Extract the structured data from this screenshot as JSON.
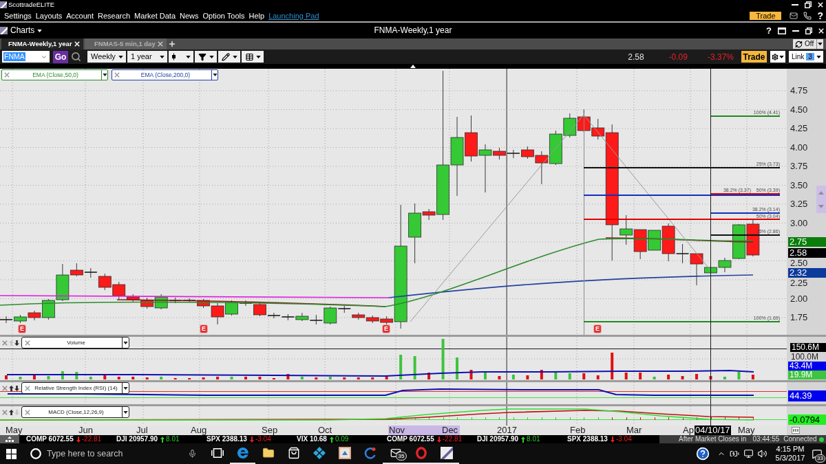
{
  "window": {
    "title": "ScottradeELITE"
  },
  "menu": [
    {
      "label": "Settings",
      "kind": "menu"
    },
    {
      "label": "Layouts",
      "kind": "menu"
    },
    {
      "label": "Account",
      "kind": "menu"
    },
    {
      "label": "Research",
      "kind": "menu"
    },
    {
      "label": "Market Data",
      "kind": "menu"
    },
    {
      "label": "News",
      "kind": "menu"
    },
    {
      "label": "Option Tools",
      "kind": "menu"
    },
    {
      "label": "Help",
      "kind": "menu"
    },
    {
      "label": "Launching Pad",
      "kind": "link"
    }
  ],
  "header_actions": {
    "trade": "Trade",
    "help": "?"
  },
  "panel": {
    "title": "Charts",
    "caption": "FNMA-Weekly,1 year",
    "help": "?"
  },
  "tabs": [
    {
      "label": "FNMA-Weekly,1 year",
      "selected": true
    },
    {
      "label": "FNMAS-5 min,1 day",
      "selected": false
    }
  ],
  "sync": {
    "label": "Off"
  },
  "toolbar": {
    "symbol": "FNMA",
    "go": "Go",
    "interval": "Weekly",
    "range": "1 year"
  },
  "quote": {
    "last": "2.58",
    "change": "-0.09",
    "change_percent": "-3.37%",
    "negative": true,
    "trade": "Trade",
    "link": "Link",
    "link_group": "3"
  },
  "studies": [
    {
      "label": "EMA (Close,50,0)",
      "color": "#2e8b2e"
    },
    {
      "label": "EMA (Close,200,0)",
      "color": "#2440a0"
    }
  ],
  "price_axis": [
    "4.75",
    "4.50",
    "4.25",
    "4.00",
    "3.75",
    "3.50",
    "3.25",
    "3.00",
    "2.50",
    "2.25",
    "2.00",
    "1.75"
  ],
  "price_badges": [
    {
      "value": "2.75",
      "color": "#0a7d0a"
    },
    {
      "value": "2.58",
      "color": "#000000"
    },
    {
      "value": "2.32",
      "color": "#0b3a9c"
    }
  ],
  "fib_levels": [
    {
      "label": "100% (4.41)",
      "color": "#1f8a1f"
    },
    {
      "label": "25% (3.73)",
      "color": "#111111"
    },
    {
      "label": "38.2% (3.37)",
      "color": "#1030c0"
    },
    {
      "label": "50% (3.39)",
      "color": "#e00000"
    },
    {
      "label": "38.2% (3.14)",
      "color": "#1030c0"
    },
    {
      "label": "50% (3.04)",
      "color": "#e00000"
    },
    {
      "label": "25% (2.86)",
      "color": "#111111"
    },
    {
      "label": "100% (1.69)",
      "color": "#1f8a1f"
    }
  ],
  "earnings_markers": [
    "E",
    "E",
    "E",
    "E"
  ],
  "volume": {
    "title": "Volume",
    "up_disabled": true,
    "down_disabled": false,
    "scale": [
      {
        "value": "150.6M",
        "kind": "marker"
      },
      {
        "value": "100.0M",
        "kind": "tick"
      },
      {
        "value": "43.4M",
        "kind": "series",
        "color": "#0000ee"
      },
      {
        "value": "19.9M",
        "kind": "series",
        "color": "#3ec43e"
      }
    ]
  },
  "rsi": {
    "title": "Relative Strength Index (RSI) (14)",
    "up_disabled": false,
    "down_disabled": false,
    "value": "44.39"
  },
  "macd": {
    "title": "MACD (Close,12,26,9)",
    "up_disabled": false,
    "down_disabled": true,
    "value": "-0.0794"
  },
  "x_axis": [
    {
      "label": "May",
      "kind": "period",
      "highlighted": false
    },
    {
      "label": "Jun",
      "kind": "period",
      "highlighted": false
    },
    {
      "label": "Jul",
      "kind": "period",
      "highlighted": false
    },
    {
      "label": "Aug",
      "kind": "period",
      "highlighted": false
    },
    {
      "label": "Sep",
      "kind": "period",
      "highlighted": false
    },
    {
      "label": "Oct",
      "kind": "period",
      "highlighted": false
    },
    {
      "label": "Nov",
      "kind": "period",
      "highlighted": true
    },
    {
      "label": "Dec",
      "kind": "period",
      "highlighted": true
    },
    {
      "label": "2017",
      "kind": "period",
      "highlighted": false
    },
    {
      "label": "Feb",
      "kind": "period",
      "highlighted": false
    },
    {
      "label": "Mar",
      "kind": "period",
      "highlighted": false
    },
    {
      "label": "Ap",
      "kind": "period",
      "highlighted": false
    },
    {
      "label": "04/10/17",
      "kind": "cursor",
      "highlighted": false
    },
    {
      "label": "May",
      "kind": "period",
      "highlighted": false
    }
  ],
  "ticker": [
    {
      "label": "COMP 6072.55",
      "change": "-22.81",
      "rising": false
    },
    {
      "label": "DJI 20957.90",
      "change": "8.01",
      "rising": true
    },
    {
      "label": "SPX 2388.13",
      "change": "-3.04",
      "rising": false
    },
    {
      "label": "VIX 10.68",
      "change": "0.09",
      "rising": true
    },
    {
      "label": "COMP 6072.55",
      "change": "-22.81",
      "rising": false
    },
    {
      "label": "DJI 20957.90",
      "change": "8.01",
      "rising": true
    },
    {
      "label": "SPX 2388.13",
      "change": "-3.04",
      "rising": false
    }
  ],
  "market_status": {
    "label": "After Market Closes in",
    "countdown": "03:44:55",
    "connection": "Connected",
    "connected": true
  },
  "taskbar": {
    "search_placeholder": "Type here to search",
    "apps": [
      {
        "kind": "task_view",
        "open": false
      },
      {
        "kind": "edge",
        "open": true
      },
      {
        "kind": "explorer",
        "open": false
      },
      {
        "kind": "store",
        "open": false
      },
      {
        "kind": "kodi",
        "open": false
      },
      {
        "kind": "tile_app",
        "open": false
      },
      {
        "kind": "ccleaner",
        "open": false
      },
      {
        "kind": "mail",
        "open": true,
        "badge": "35"
      },
      {
        "kind": "opera",
        "open": true
      },
      {
        "kind": "chart_app",
        "open": true
      }
    ],
    "time": "4:15 PM",
    "date": "5/3/2017",
    "notifications": "33"
  }
}
